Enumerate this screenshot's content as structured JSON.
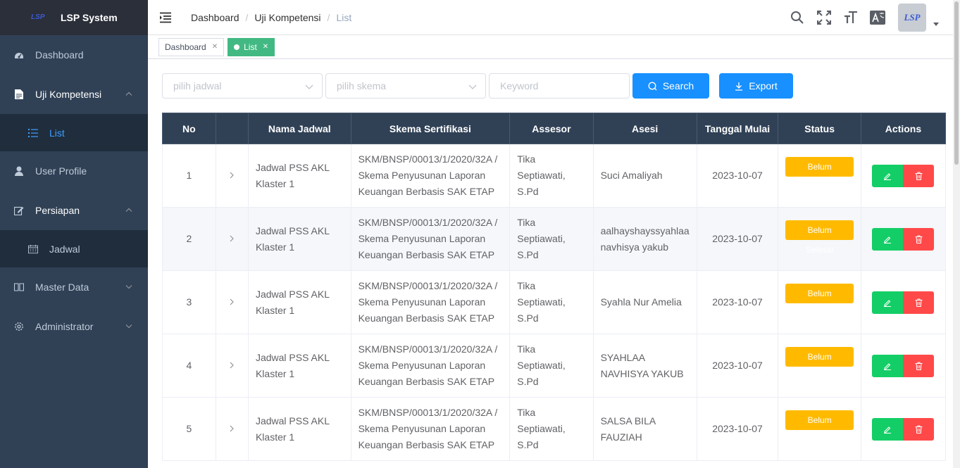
{
  "app": {
    "title": "LSP System",
    "logo_text": "LSP"
  },
  "sidebar": {
    "items": [
      {
        "label": "Dashboard"
      },
      {
        "label": "Uji Kompetensi"
      },
      {
        "label": "List"
      },
      {
        "label": "User Profile"
      },
      {
        "label": "Persiapan"
      },
      {
        "label": "Jadwal"
      },
      {
        "label": "Master Data"
      },
      {
        "label": "Administrator"
      }
    ]
  },
  "breadcrumb": {
    "items": [
      "Dashboard",
      "Uji Kompetensi",
      "List"
    ],
    "sep": "/"
  },
  "header": {
    "avatar_text": "LSP"
  },
  "tags": [
    {
      "label": "Dashboard"
    },
    {
      "label": "List"
    }
  ],
  "filters": {
    "jadwal_placeholder": "pilih jadwal",
    "skema_placeholder": "pilih skema",
    "keyword_placeholder": "Keyword",
    "search_label": "Search",
    "export_label": "Export"
  },
  "table": {
    "columns": [
      "No",
      "",
      "Nama Jadwal",
      "Skema Sertifikasi",
      "Assesor",
      "Asesi",
      "Tanggal Mulai",
      "Status",
      "Actions"
    ],
    "rows": [
      {
        "no": "1",
        "jadwal": "Jadwal PSS AKL Klaster 1",
        "skema": "SKM/BNSP/00013/1/2020/32A / Skema Penyusunan Laporan Keuangan Berbasis SAK ETAP",
        "assesor": "Tika Septiawati, S.Pd",
        "asesi": "Suci Amaliyah",
        "tanggal": "2023-10-07",
        "status": "Belum Selesai"
      },
      {
        "no": "2",
        "jadwal": "Jadwal PSS AKL Klaster 1",
        "skema": "SKM/BNSP/00013/1/2020/32A / Skema Penyusunan Laporan Keuangan Berbasis SAK ETAP",
        "assesor": "Tika Septiawati, S.Pd",
        "asesi": "aalhayshayssyahlaa navhisya yakub",
        "tanggal": "2023-10-07",
        "status": "Belum Selesai"
      },
      {
        "no": "3",
        "jadwal": "Jadwal PSS AKL Klaster 1",
        "skema": "SKM/BNSP/00013/1/2020/32A / Skema Penyusunan Laporan Keuangan Berbasis SAK ETAP",
        "assesor": "Tika Septiawati, S.Pd",
        "asesi": "Syahla Nur Amelia",
        "tanggal": "2023-10-07",
        "status": "Belum Selesai"
      },
      {
        "no": "4",
        "jadwal": "Jadwal PSS AKL Klaster 1",
        "skema": "SKM/BNSP/00013/1/2020/32A / Skema Penyusunan Laporan Keuangan Berbasis SAK ETAP",
        "assesor": "Tika Septiawati, S.Pd",
        "asesi": "SYAHLAA NAVHISYA YAKUB",
        "tanggal": "2023-10-07",
        "status": "Belum Selesai"
      },
      {
        "no": "5",
        "jadwal": "Jadwal PSS AKL Klaster 1",
        "skema": "SKM/BNSP/00013/1/2020/32A / Skema Penyusunan Laporan Keuangan Berbasis SAK ETAP",
        "assesor": "Tika Septiawati, S.Pd",
        "asesi": "SALSA BILA FAUZIAH",
        "tanggal": "2023-10-07",
        "status": "Belum Selesai"
      }
    ]
  },
  "colors": {
    "sidebar": "#304156",
    "accent": "#409eff",
    "tag_active": "#42b983",
    "status": "#ffba00",
    "edit": "#13ce66",
    "delete": "#ff4949"
  }
}
